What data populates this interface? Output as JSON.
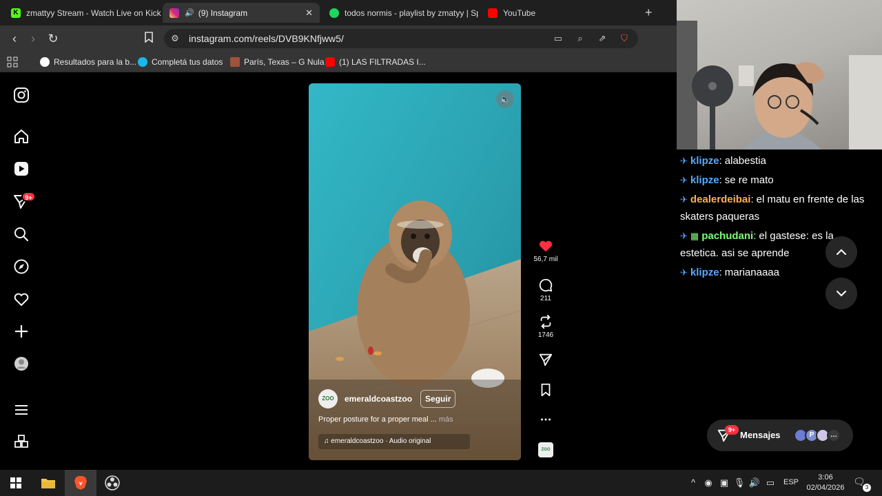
{
  "browser": {
    "tabs": [
      {
        "title": "zmattyy Stream - Watch Live on Kick",
        "favicon": "kick-icon",
        "color": "#53fc18"
      },
      {
        "title": "(9) Instagram",
        "favicon": "instagram-icon",
        "active": true,
        "close": "✕"
      },
      {
        "title": "todos normis - playlist by zmatyy | Sp",
        "favicon": "spotify-icon",
        "color": "#1ed760"
      },
      {
        "title": "YouTube",
        "favicon": "youtube-icon",
        "color": "#ff0000"
      }
    ],
    "new_tab": "+",
    "url": "instagram.com/reels/DVB9KNfjww5/",
    "bookmarks": [
      {
        "label": "Resultados para la b..."
      },
      {
        "label": "Completá tus datos"
      },
      {
        "label": "París, Texas – G Nula"
      },
      {
        "label": "(1) LAS FILTRADAS I..."
      }
    ]
  },
  "instagram": {
    "notification_badge": "9+",
    "reel": {
      "owner": "emeraldcoastzoo",
      "avatar_text": "ZOO",
      "follow_label": "Seguir",
      "caption": "Proper posture for a proper meal ...",
      "caption_more": "más",
      "audio": "emeraldcoastzoo · Audio original"
    },
    "actions": {
      "likes": "56,7 mil",
      "comments": "211",
      "reposts": "1746"
    },
    "messages": {
      "label": "Mensajes",
      "badge": "9+"
    }
  },
  "chat": {
    "messages": [
      {
        "user": "klipze",
        "user_color": "#5aa9ff",
        "text": "alabestia"
      },
      {
        "user": "klipze",
        "user_color": "#5aa9ff",
        "text": "se re mato"
      },
      {
        "user": "dealerdeibai",
        "user_color": "#ffb24a",
        "text": "el matu en frente de las skaters paqueras"
      },
      {
        "user": "pachudani",
        "user_color": "#7dff7a",
        "text": "el gastese: es la estetica. asi se aprende"
      },
      {
        "user": "klipze",
        "user_color": "#5aa9ff",
        "text": "marianaaaa"
      }
    ]
  },
  "taskbar": {
    "language": "ESP",
    "time": "3:06",
    "date": "02/04/2026",
    "notification_count": "3"
  }
}
